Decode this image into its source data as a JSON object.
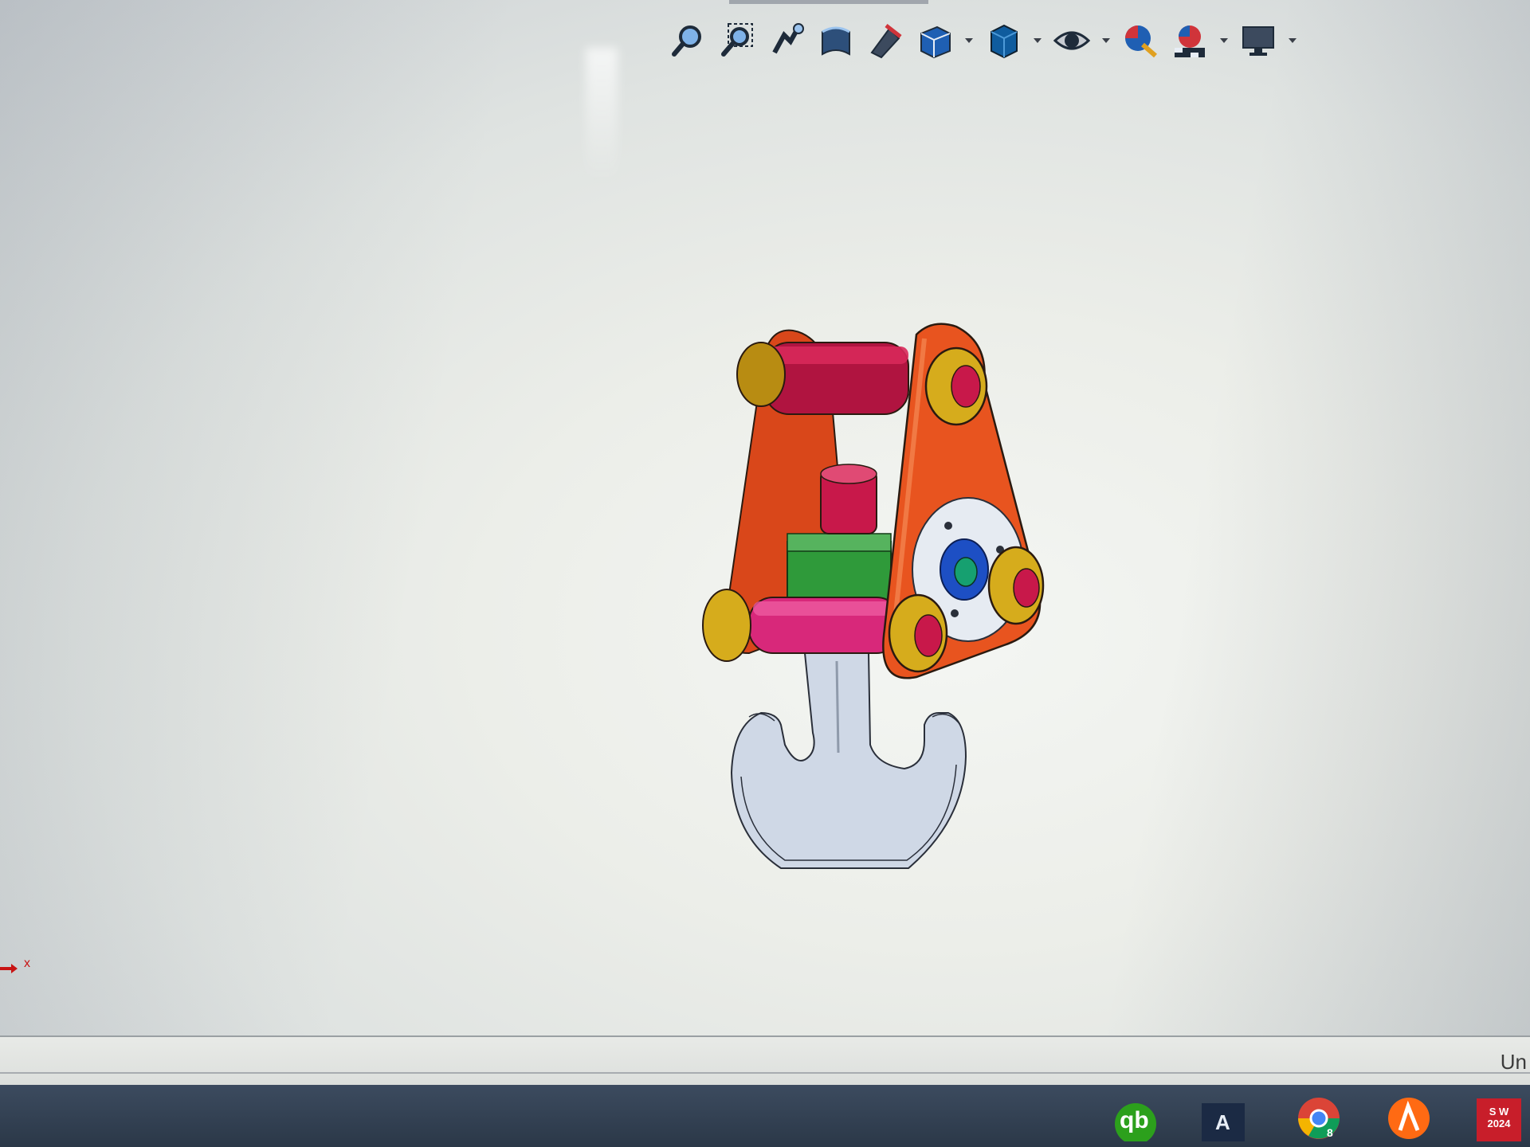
{
  "toolbar": {
    "buttons": [
      {
        "icon": "zoom-to-fit-icon"
      },
      {
        "icon": "zoom-to-area-icon"
      },
      {
        "icon": "previous-view-icon"
      },
      {
        "icon": "section-view-icon"
      },
      {
        "icon": "dynamic-annotation-views-icon"
      },
      {
        "icon": "view-orientation-icon"
      },
      {
        "icon": "display-style-icon"
      },
      {
        "icon": "hide-show-items-icon"
      },
      {
        "icon": "edit-appearance-icon"
      },
      {
        "icon": "apply-scene-icon"
      },
      {
        "icon": "view-settings-icon"
      }
    ]
  },
  "status": {
    "right_text": "Un"
  },
  "taskbar": {
    "apps": [
      {
        "icon": "quickbooks-icon",
        "label": "qb"
      },
      {
        "icon": "autocad-icon",
        "label": "A"
      },
      {
        "icon": "chrome-icon",
        "label": "8"
      },
      {
        "icon": "avast-icon",
        "label": ""
      },
      {
        "icon": "solidworks-icon",
        "label": "S W 2024"
      }
    ]
  },
  "colors": {
    "plate": "#e8541f",
    "pin": "#c8184a",
    "nut": "#d6ac1c",
    "hook": "#cfd8e6",
    "block": "#2f9a3a",
    "bearing": "#1d4fc4"
  }
}
